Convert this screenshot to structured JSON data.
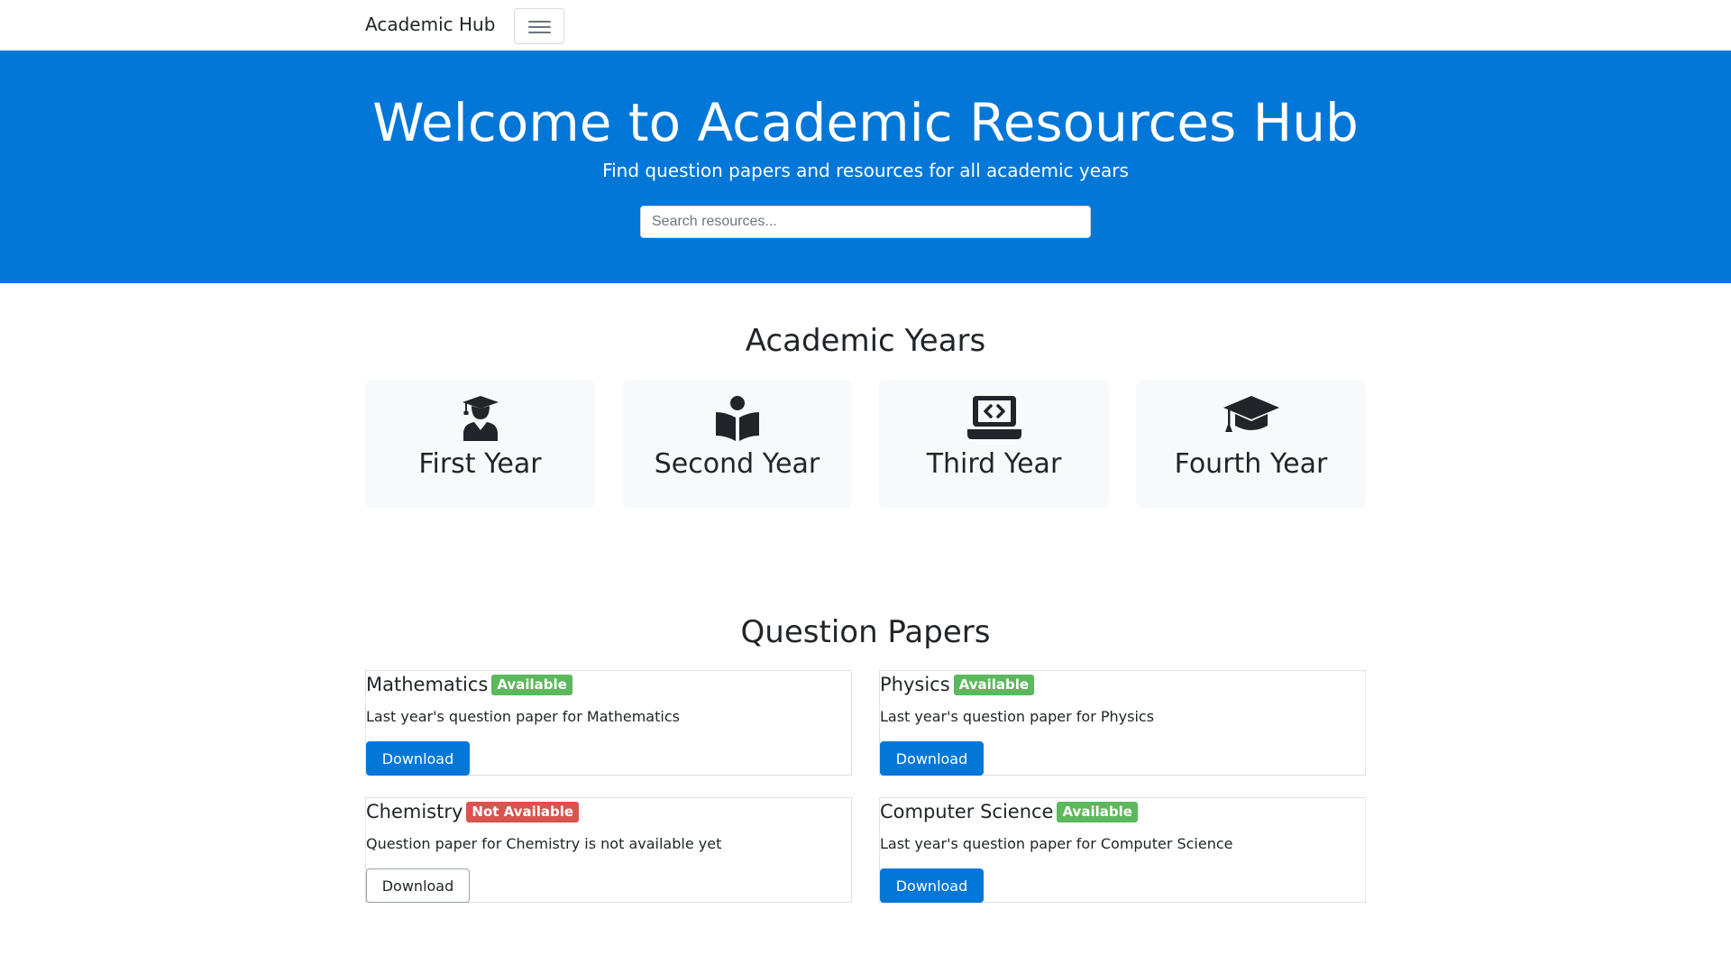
{
  "navbar": {
    "brand": "Academic Hub",
    "menu_icon": "hamburger-icon"
  },
  "hero": {
    "title": "Welcome to Academic Resources Hub",
    "subtitle": "Find question papers and resources for all academic years",
    "search_placeholder": "Search resources..."
  },
  "years": {
    "title": "Academic Years",
    "items": [
      {
        "label": "First Year",
        "icon": "graduate-user-icon"
      },
      {
        "label": "Second Year",
        "icon": "book-reader-icon"
      },
      {
        "label": "Third Year",
        "icon": "laptop-code-icon"
      },
      {
        "label": "Fourth Year",
        "icon": "graduation-cap-icon"
      }
    ]
  },
  "papers": {
    "title": "Question Papers",
    "items": [
      {
        "subject": "Mathematics",
        "status": "Available",
        "description": "Last year's question paper for Mathematics",
        "button": "Download"
      },
      {
        "subject": "Physics",
        "status": "Available",
        "description": "Last year's question paper for Physics",
        "button": "Download"
      },
      {
        "subject": "Chemistry",
        "status": "Not Available",
        "description": "Question paper for Chemistry is not available yet",
        "button": "Download"
      },
      {
        "subject": "Computer Science",
        "status": "Available",
        "description": "Last year's question paper for Computer Science",
        "button": "Download"
      }
    ]
  },
  "colors": {
    "primary": "#0277d8",
    "available": "#5cb85c",
    "not_available": "#d9534f",
    "card_bg": "#f8f9fa"
  }
}
